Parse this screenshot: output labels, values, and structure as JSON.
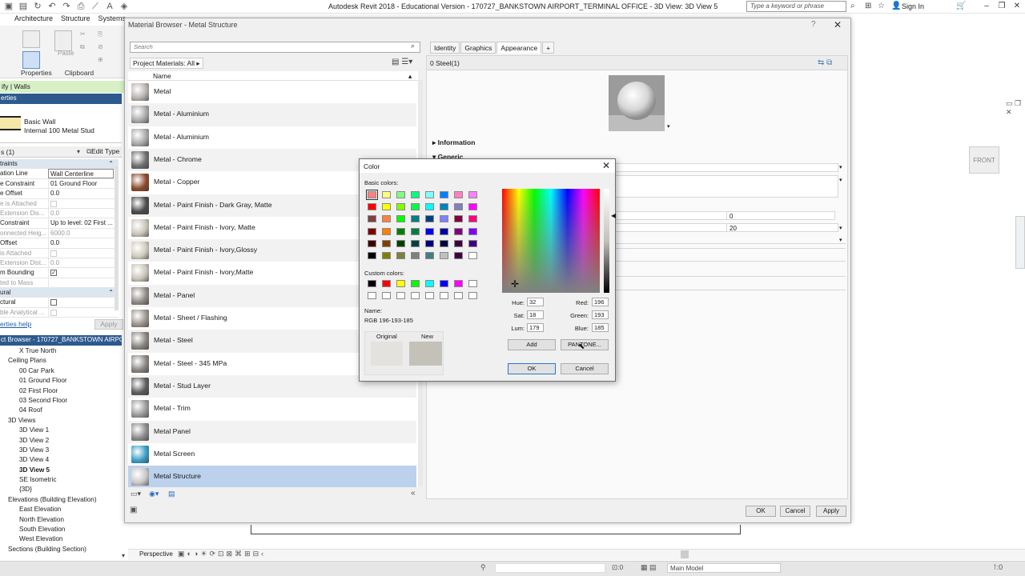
{
  "app": {
    "title": "Autodesk Revit 2018 - Educational Version -   170727_BANKSTOWN AIRPORT_TERMINAL OFFICE - 3D View: 3D View 5",
    "search_placeholder": "Type a keyword or phrase",
    "sign_in": "Sign In"
  },
  "ribbon": {
    "tabs": [
      "Architecture",
      "Structure",
      "Systems"
    ],
    "panel_labels": [
      "Properties",
      "Clipboard"
    ],
    "paste_label": "Paste",
    "modify_text": "ify | Walls"
  },
  "properties": {
    "header": "erties",
    "type_family": "Basic Wall",
    "type_name": "Internal 100 Metal Stud",
    "instance_filter": "s (1)",
    "edit_type": "Edit Type",
    "rows": [
      {
        "k": "traints",
        "v": "",
        "section": true
      },
      {
        "k": "ation Line",
        "v": "Wall Centerline"
      },
      {
        "k": "e Constraint",
        "v": "01 Ground Floor"
      },
      {
        "k": "e Offset",
        "v": "0.0"
      },
      {
        "k": "e is Attached",
        "v": "",
        "dim": true
      },
      {
        "k": "Extension Dis...",
        "v": "0.0",
        "dim": true
      },
      {
        "k": "Constraint",
        "v": "Up to level: 02 First ..."
      },
      {
        "k": "onnected Heig...",
        "v": "6000.0",
        "dim": true
      },
      {
        "k": "Offset",
        "v": "0.0"
      },
      {
        "k": "is Attached",
        "v": "",
        "dim": true
      },
      {
        "k": "Extension Dist...",
        "v": "0.0",
        "dim": true
      },
      {
        "k": "m Bounding",
        "v": "✓"
      },
      {
        "k": "ted to Mass",
        "v": "",
        "dim": true
      },
      {
        "k": "ural",
        "v": "",
        "section": true
      },
      {
        "k": "ctural",
        "v": "□"
      },
      {
        "k": "ble Analytical ...",
        "v": "",
        "dim": true
      }
    ],
    "help_link": "erties help",
    "apply": "Apply"
  },
  "project_browser": {
    "header": "ct Browser - 170727_BANKSTOWN AIRPO...",
    "items": [
      {
        "label": "X True North",
        "indent": 24
      },
      {
        "label": "Ceiling Plans",
        "indent": 10
      },
      {
        "label": "00 Car Park",
        "indent": 24
      },
      {
        "label": "01 Ground Floor",
        "indent": 24
      },
      {
        "label": "02 First Floor",
        "indent": 24
      },
      {
        "label": "03 Second Floor",
        "indent": 24
      },
      {
        "label": "04 Roof",
        "indent": 24
      },
      {
        "label": "3D Views",
        "indent": 10
      },
      {
        "label": "3D View 1",
        "indent": 24
      },
      {
        "label": "3D View 2",
        "indent": 24
      },
      {
        "label": "3D View 3",
        "indent": 24
      },
      {
        "label": "3D View 4",
        "indent": 24
      },
      {
        "label": "3D View 5",
        "indent": 24,
        "bold": true
      },
      {
        "label": "SE Isometric",
        "indent": 24
      },
      {
        "label": "{3D}",
        "indent": 24
      },
      {
        "label": "Elevations (Building Elevation)",
        "indent": 10
      },
      {
        "label": "East Elevation",
        "indent": 24
      },
      {
        "label": "North Elevation",
        "indent": 24
      },
      {
        "label": "South Elevation",
        "indent": 24
      },
      {
        "label": "West Elevation",
        "indent": 24
      },
      {
        "label": "Sections (Building Section)",
        "indent": 10
      }
    ]
  },
  "material_browser": {
    "title": "Material Browser - Metal Structure",
    "help": "?",
    "search_placeholder": "Search",
    "project_materials": "Project Materials: All",
    "column_name": "Name",
    "materials": [
      {
        "name": "Metal",
        "color": "#b9b2ad"
      },
      {
        "name": "Metal - Aluminium",
        "color": "#a9a9a9"
      },
      {
        "name": "Metal - Aluminium",
        "color": "#a9a9a9"
      },
      {
        "name": "Metal - Chrome",
        "color": "#6e6e6e"
      },
      {
        "name": "Metal - Copper",
        "color": "#8d4a2c"
      },
      {
        "name": "Metal - Paint Finish - Dark Gray, Matte",
        "color": "#4c4c4c"
      },
      {
        "name": "Metal - Paint Finish - Ivory, Matte",
        "color": "#c9c4b8"
      },
      {
        "name": "Metal - Paint Finish - Ivory,Glossy",
        "color": "#d0cbbd"
      },
      {
        "name": "Metal - Paint Finish - Ivory,Matte",
        "color": "#c9c4b8"
      },
      {
        "name": "Metal - Panel",
        "color": "#8f8a86"
      },
      {
        "name": "Metal - Sheet / Flashing",
        "color": "#9c948e"
      },
      {
        "name": "Metal - Steel",
        "color": "#8a8580"
      },
      {
        "name": "Metal - Steel - 345 MPa",
        "color": "#8a8580"
      },
      {
        "name": "Metal - Stud Layer",
        "color": "#5d5d5d"
      },
      {
        "name": "Metal - Trim",
        "color": "#9a9a9a"
      },
      {
        "name": "Metal Panel",
        "color": "#8b8b8b"
      },
      {
        "name": "Metal Screen",
        "color": "#3a9ec7"
      },
      {
        "name": "Metal Structure",
        "color": "#c8c8c8",
        "selected": true
      }
    ],
    "tabs": [
      "Identity",
      "Graphics",
      "Appearance"
    ],
    "add_tab": "+",
    "asset_count": "0",
    "asset_name": "Steel(1)",
    "info_header": "Information",
    "generic_header": "Generic",
    "field_zero": "0",
    "field_twenty": "20",
    "ok": "OK",
    "cancel": "Cancel",
    "apply": "Apply"
  },
  "color_dialog": {
    "title": "Color",
    "basic_colors_label": "Basic colors:",
    "custom_colors_label": "Custom colors:",
    "basic_colors": [
      "#ff8080",
      "#ffff80",
      "#80ff80",
      "#00ff80",
      "#80ffff",
      "#0080ff",
      "#ff80c0",
      "#ff80ff",
      "#ff0000",
      "#ffff00",
      "#80ff00",
      "#00ff40",
      "#00ffff",
      "#0080c0",
      "#8080c0",
      "#ff00ff",
      "#804040",
      "#ff8040",
      "#00ff00",
      "#008080",
      "#004080",
      "#8080ff",
      "#800040",
      "#ff0080",
      "#800000",
      "#ff8000",
      "#008000",
      "#008040",
      "#0000ff",
      "#0000a0",
      "#800080",
      "#8000ff",
      "#400000",
      "#804000",
      "#004000",
      "#004040",
      "#000080",
      "#000040",
      "#400040",
      "#400080",
      "#000000",
      "#808000",
      "#808040",
      "#808080",
      "#408080",
      "#c0c0c0",
      "#400040",
      "#ffffff"
    ],
    "custom_colors": [
      "#000000",
      "#ff0000",
      "#ffff00",
      "#00ff00",
      "#00ffff",
      "#0000ff",
      "#ff00ff",
      "#ffffff",
      "#ffffff",
      "#ffffff",
      "#ffffff",
      "#ffffff",
      "#ffffff",
      "#ffffff",
      "#ffffff",
      "#ffffff"
    ],
    "name_label": "Name:",
    "name_value": "RGB 196-193-185",
    "original_label": "Original",
    "new_label": "New",
    "original_color": "#e3e2de",
    "new_color": "#c4c1b9",
    "hue_label": "Hue:",
    "hue": "32",
    "sat_label": "Sat:",
    "sat": "18",
    "lum_label": "Lum:",
    "lum": "179",
    "red_label": "Red:",
    "red": "196",
    "green_label": "Green:",
    "green": "193",
    "blue_label": "Blue:",
    "blue": "185",
    "add": "Add",
    "pantone": "PANTONE...",
    "ok": "OK",
    "cancel": "Cancel"
  },
  "viewcube": {
    "label": "FRONT"
  },
  "view_control": {
    "perspective": "Perspective"
  },
  "status": {
    "model": "Main Model",
    "zero": ":0"
  }
}
